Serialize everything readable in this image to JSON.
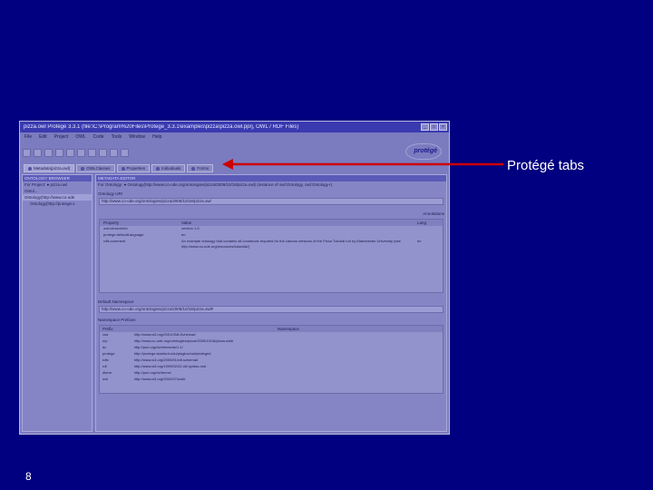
{
  "window": {
    "title": "pizza.owl Protégé 3.3.1   (file:\\C:\\Program%20Files\\Protege_3.3.1\\examples\\pizza\\pizza.owl.pprj, OWL / RDF Files)",
    "menu": [
      "File",
      "Edit",
      "Project",
      "OWL",
      "Code",
      "Tools",
      "Window",
      "Help"
    ],
    "logo_text": "protégé",
    "tabs": [
      {
        "label": "Metadata(pizza.owl)",
        "active": true
      },
      {
        "label": "OWLClasses",
        "active": false
      },
      {
        "label": "Properties",
        "active": false
      },
      {
        "label": "Individuals",
        "active": false
      },
      {
        "label": "Forms",
        "active": false
      }
    ]
  },
  "left_panel": {
    "header": "ONTOLOGY BROWSER",
    "for_project": "For Project:  ● pizza.owl",
    "onto_label": "Ontol...",
    "tree": [
      "Ontology(http://www.co-ode",
      "Ontology(http://protege.s"
    ]
  },
  "main_panel": {
    "header": "METADATA EDITOR",
    "for_ontology": "For Ontology:  ● Ontology(http://www.co-ode.org/ontologies/pizza/2005/10/18/pizza.owl)   (instance of owl:Ontology, owl:Ontology+)",
    "ontology_uri_label": "Ontology URI",
    "ontology_uri": "http://www.co-ode.org/ontologies/pizza/2005/10/18/pizza.owl",
    "annotations_label": "Annotations",
    "annotation_columns": [
      "Property",
      "Value",
      "Lang"
    ],
    "annotations": [
      {
        "property": "owl:versionInfo",
        "value": "version 1.5",
        "lang": ""
      },
      {
        "property": "protege:defaultLanguage",
        "value": "en",
        "lang": ""
      },
      {
        "property": "rdfs:comment",
        "value": "An example ontology that contains all constructs required for the various versions of the Pizza Tutorial run by Manchester University (see http://www.co-ode.org/resources/tutorials/)",
        "lang": "en"
      }
    ],
    "default_namespace_label": "Default Namespace",
    "default_namespace": "http://www.co-ode.org/ontologies/pizza/2005/10/18/pizza.owl#",
    "prefixes_label": "Namespace Prefixes",
    "prefix_columns": [
      "Prefix",
      "Namespace"
    ],
    "prefixes": [
      {
        "prefix": "xsd",
        "namespace": "http://www.w3.org/2001/XMLSchema#"
      },
      {
        "prefix": "mp",
        "namespace": "http://www.co-ode.org/ontologies/pizza/2005/10/18/pizza.owl#"
      },
      {
        "prefix": "dc",
        "namespace": "http://purl.org/dc/elements/1.1/"
      },
      {
        "prefix": "protege",
        "namespace": "http://protege.stanford.edu/plugins/owl/protege#"
      },
      {
        "prefix": "rdfs",
        "namespace": "http://www.w3.org/2000/01/rdf-schema#"
      },
      {
        "prefix": "rdf",
        "namespace": "http://www.w3.org/1999/02/22-rdf-syntax-ns#"
      },
      {
        "prefix": "dterm",
        "namespace": "http://purl.org/dc/terms/"
      },
      {
        "prefix": "owl",
        "namespace": "http://www.w3.org/2002/07/owl#"
      }
    ]
  },
  "callout": {
    "label": "Protégé tabs",
    "color": "#cc0000"
  },
  "slide_number": "8"
}
